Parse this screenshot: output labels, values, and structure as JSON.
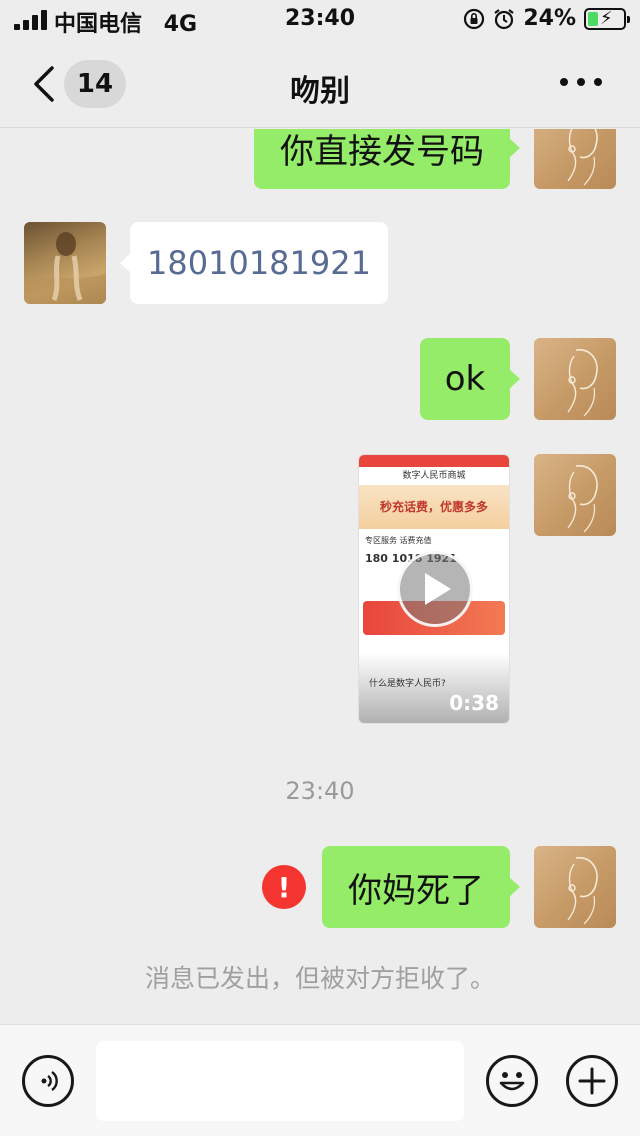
{
  "status_bar": {
    "carrier": "中国电信",
    "network": "4G",
    "time": "23:40",
    "battery": "24%"
  },
  "nav": {
    "unread_count": "14",
    "title": "吻别"
  },
  "messages": {
    "m1_text": "你直接发号码",
    "m2_text": "18010181921",
    "m3_text": "ok",
    "m5_text": "你妈死了"
  },
  "video": {
    "duration": "0:38",
    "preview": {
      "header": "数字人民币商城",
      "banner": "秒充话费，优惠多多",
      "section": "专区服务  话费充值",
      "number": "180 1018 1921",
      "question": "什么是数字人民币?"
    }
  },
  "timestamp": "23:40",
  "failed_mark": "!",
  "system_notice": "消息已发出，但被对方拒收了。",
  "input": {
    "value": ""
  },
  "colors": {
    "outgoing_bubble": "#95ec69",
    "incoming_bubble": "#ffffff",
    "link_text": "#576b95",
    "error": "#f43530",
    "background": "#ededed"
  },
  "icons": {
    "back": "chevron-left-icon",
    "more": "more-horizontal-icon",
    "voice": "voice-icon",
    "emoji": "emoji-icon",
    "add": "plus-icon",
    "play": "play-icon"
  }
}
